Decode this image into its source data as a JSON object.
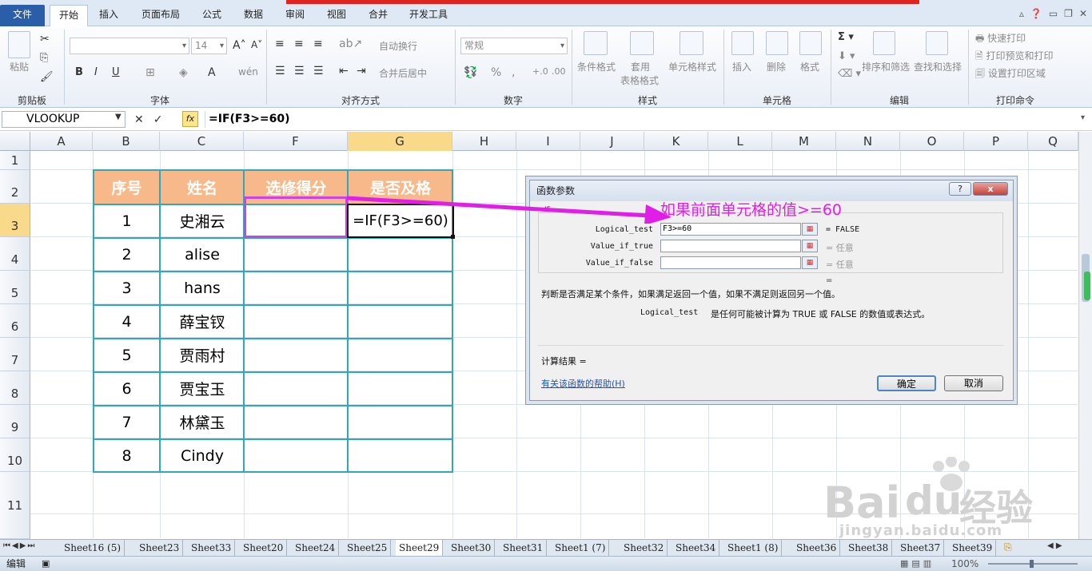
{
  "ribbon": {
    "tabs": [
      "文件",
      "开始",
      "插入",
      "页面布局",
      "公式",
      "数据",
      "审阅",
      "视图",
      "合并",
      "开发工具"
    ],
    "groups": [
      "剪贴板",
      "字体",
      "对齐方式",
      "数字",
      "样式",
      "单元格",
      "编辑",
      "打印命令"
    ],
    "clipboard": {
      "paste": "粘贴"
    },
    "font": {
      "size": "14"
    },
    "alignment": {
      "wrap": "自动换行",
      "merge": "合并后居中"
    },
    "number": {
      "format": "常规"
    },
    "styles": {
      "conditional": "条件格式",
      "table": "套用",
      "table2": "表格格式",
      "cell": "单元格样式"
    },
    "cells": {
      "insert": "插入",
      "delete": "删除",
      "format": "格式"
    },
    "editing": {
      "sort": "排序和筛选",
      "find": "查找和选择"
    },
    "print": {
      "quick": "快速打印",
      "preview": "打印预览和打印",
      "area": "设置打印区域"
    }
  },
  "formula_bar": {
    "name_box": "VLOOKUP",
    "formula": "=IF(F3>=60)"
  },
  "columns": [
    "A",
    "B",
    "C",
    "F",
    "G",
    "H",
    "I",
    "J",
    "K",
    "L",
    "M",
    "N",
    "O",
    "P",
    "Q"
  ],
  "rows": [
    "1",
    "2",
    "3",
    "4",
    "5",
    "6",
    "7",
    "8",
    "9",
    "10",
    "11"
  ],
  "table": {
    "headers": [
      "序号",
      "姓名",
      "选修得分",
      "是否及格"
    ],
    "rows": [
      {
        "no": "1",
        "name": "史湘云",
        "score": "",
        "pass": "=IF(F3>=60)"
      },
      {
        "no": "2",
        "name": "alise",
        "score": "",
        "pass": ""
      },
      {
        "no": "3",
        "name": "hans",
        "score": "",
        "pass": ""
      },
      {
        "no": "4",
        "name": "薛宝钗",
        "score": "",
        "pass": ""
      },
      {
        "no": "5",
        "name": "贾雨村",
        "score": "",
        "pass": ""
      },
      {
        "no": "6",
        "name": "贾宝玉",
        "score": "",
        "pass": ""
      },
      {
        "no": "7",
        "name": "林黛玉",
        "score": "",
        "pass": ""
      },
      {
        "no": "8",
        "name": "Cindy",
        "score": "",
        "pass": ""
      }
    ]
  },
  "annotation": "如果前面单元格的值>=60",
  "dialog": {
    "title": "函数参数",
    "func": "IF",
    "help_q": "?",
    "close": "x",
    "args": [
      {
        "label": "Logical_test",
        "value": "F3>=60",
        "result": "= FALSE"
      },
      {
        "label": "Value_if_true",
        "value": "",
        "result": "= 任意"
      },
      {
        "label": "Value_if_false",
        "value": "",
        "result": "= 任意"
      }
    ],
    "eq": "=",
    "description": "判断是否满足某个条件，如果满足返回一个值，如果不满足则返回另一个值。",
    "arg_help_name": "Logical_test",
    "arg_help_text": "是任何可能被计算为 TRUE 或 FALSE 的数值或表达式。",
    "result_label": "计算结果 =",
    "help_link": "有关该函数的帮助(H)",
    "ok": "确定",
    "cancel": "取消"
  },
  "sheets": [
    "Sheet16 (5)",
    "Sheet23",
    "Sheet33",
    "Sheet20",
    "Sheet24",
    "Sheet25",
    "Sheet29",
    "Sheet30",
    "Sheet31",
    "Sheet1 (7)",
    "Sheet32",
    "Sheet34",
    "Sheet1 (8)",
    "Sheet36",
    "Sheet38",
    "Sheet37",
    "Sheet39"
  ],
  "active_sheet": "Sheet29",
  "status": {
    "mode": "编辑",
    "zoom": "100%"
  },
  "watermark": {
    "brand": "Bai",
    "brand2": "经验",
    "url": "jingyan.baidu.com"
  }
}
